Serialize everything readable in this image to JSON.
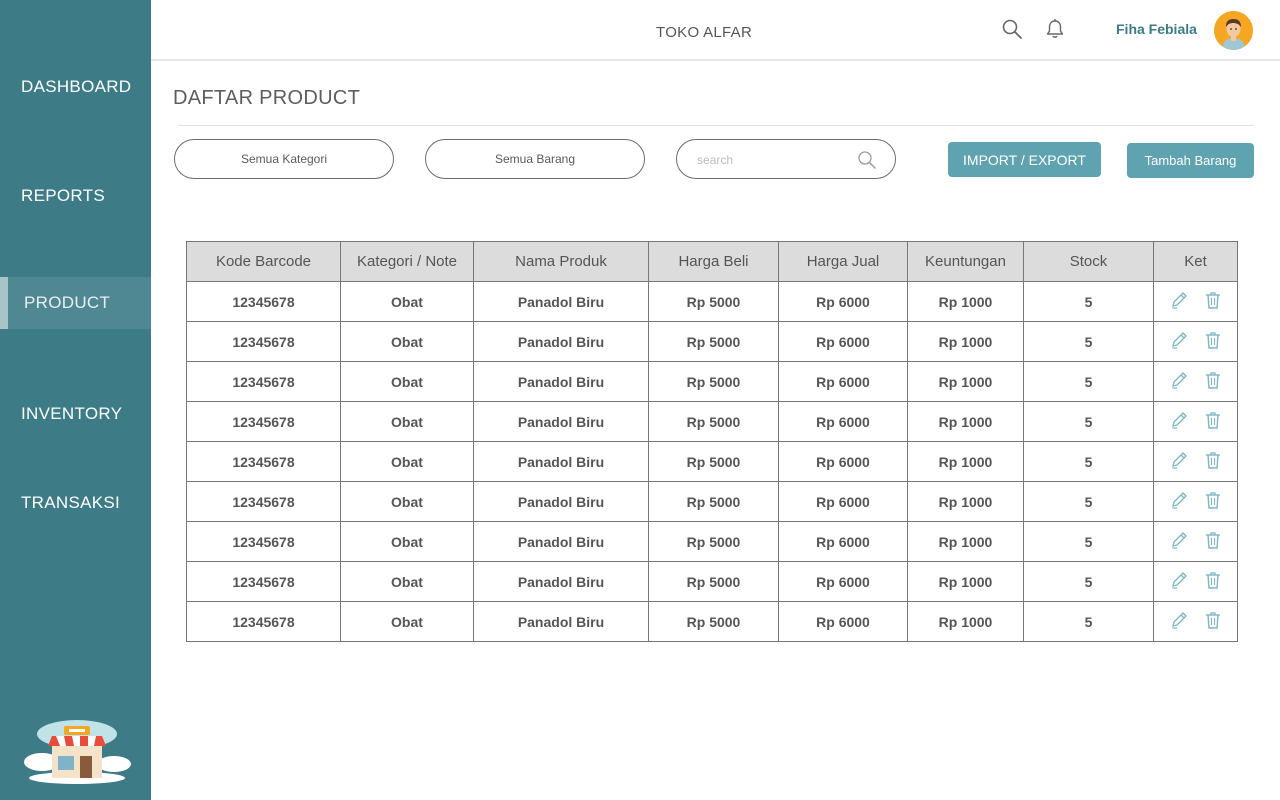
{
  "sidebar": {
    "items": [
      {
        "label": "DASHBOARD",
        "active": false
      },
      {
        "label": "REPORTS",
        "active": false
      },
      {
        "label": "PRODUCT",
        "active": true
      },
      {
        "label": "INVENTORY",
        "active": false
      },
      {
        "label": "TRANSAKSI",
        "active": false
      }
    ],
    "logo_icon": "shop-storefront-icon"
  },
  "header": {
    "store_name": "TOKO ALFAR",
    "search_icon": "search-icon",
    "notification_icon": "bell-icon",
    "user_name": "Fiha Febiala",
    "avatar_icon": "user-avatar-icon"
  },
  "main": {
    "title": "DAFTAR PRODUCT",
    "filters": {
      "category_label": "Semua Kategori",
      "items_label": "Semua Barang",
      "search_placeholder": "search"
    },
    "buttons": {
      "import_export": "IMPORT / EXPORT",
      "add_item": "Tambah Barang"
    },
    "table": {
      "headers": [
        "Kode Barcode",
        "Kategori / Note",
        "Nama Produk",
        "Harga Beli",
        "Harga Jual",
        "Keuntungan",
        "Stock",
        "Ket"
      ],
      "rows": [
        [
          "12345678",
          "Obat",
          "Panadol Biru",
          "Rp 5000",
          "Rp 6000",
          "Rp 1000",
          "5"
        ],
        [
          "12345678",
          "Obat",
          "Panadol Biru",
          "Rp 5000",
          "Rp 6000",
          "Rp 1000",
          "5"
        ],
        [
          "12345678",
          "Obat",
          "Panadol Biru",
          "Rp 5000",
          "Rp 6000",
          "Rp 1000",
          "5"
        ],
        [
          "12345678",
          "Obat",
          "Panadol Biru",
          "Rp 5000",
          "Rp 6000",
          "Rp 1000",
          "5"
        ],
        [
          "12345678",
          "Obat",
          "Panadol Biru",
          "Rp 5000",
          "Rp 6000",
          "Rp 1000",
          "5"
        ],
        [
          "12345678",
          "Obat",
          "Panadol Biru",
          "Rp 5000",
          "Rp 6000",
          "Rp 1000",
          "5"
        ],
        [
          "12345678",
          "Obat",
          "Panadol Biru",
          "Rp 5000",
          "Rp 6000",
          "Rp 1000",
          "5"
        ],
        [
          "12345678",
          "Obat",
          "Panadol Biru",
          "Rp 5000",
          "Rp 6000",
          "Rp 1000",
          "5"
        ],
        [
          "12345678",
          "Obat",
          "Panadol Biru",
          "Rp 5000",
          "Rp 6000",
          "Rp 1000",
          "5"
        ]
      ],
      "row_actions": [
        "edit-pencil-icon",
        "delete-trash-icon"
      ]
    }
  },
  "colors": {
    "sidebar_bg": "#3d7b87",
    "accent_button": "#5fa3b0",
    "user_name": "#3d7b87",
    "table_header_bg": "#dcdcdc"
  }
}
